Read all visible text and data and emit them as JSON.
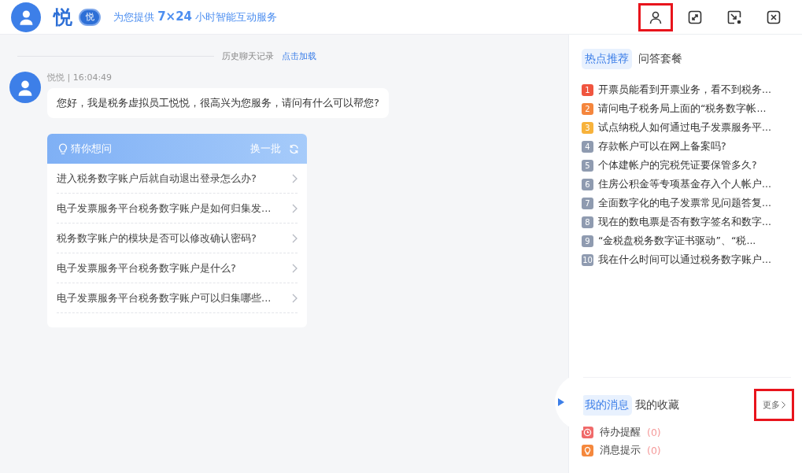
{
  "header": {
    "brand": "悦",
    "brand_badge": "悦",
    "slogan": "为您提供 **7×24** 小时智能互动服务",
    "tools": [
      {
        "kind": "user",
        "highlighted": true
      },
      {
        "kind": "expand",
        "highlighted": false
      },
      {
        "kind": "shrink",
        "highlighted": false
      },
      {
        "kind": "close",
        "highlighted": false
      }
    ]
  },
  "chat": {
    "history_label": "历史聊天记录",
    "history_link": "点击加载",
    "message": {
      "meta": "悦悦 | 16:04:49",
      "text": "您好，我是税务虚拟员工悦悦，很高兴为您服务，请问有什么可以帮您?"
    },
    "suggest": {
      "title": "猜你想问",
      "refresh": "换一批",
      "items": [
        "进入税务数字账户后就自动退出登录怎么办?",
        "电子发票服务平台税务数字账户是如何归集发...",
        "税务数字账户的模块是否可以修改确认密码?",
        "电子发票服务平台税务数字账户是什么?",
        "电子发票服务平台税务数字账户可以归集哪些..."
      ]
    }
  },
  "hot": {
    "tabs": [
      {
        "label": "热点推荐",
        "selected": true
      },
      {
        "label": "问答套餐",
        "selected": false
      }
    ],
    "items": [
      {
        "rank": "1",
        "color": "#f0553f",
        "text": "开票员能看到开票业务，看不到税务..."
      },
      {
        "rank": "2",
        "color": "#f5863d",
        "text": "请问电子税务局上面的“税务数字帐..."
      },
      {
        "rank": "3",
        "color": "#f7b23b",
        "text": "试点纳税人如何通过电子发票服务平..."
      },
      {
        "rank": "4",
        "color": "#8f9bb0",
        "text": "存款帐户可以在网上备案吗?"
      },
      {
        "rank": "5",
        "color": "#8f9bb0",
        "text": "个体建帐户的完税凭证要保管多久?"
      },
      {
        "rank": "6",
        "color": "#8f9bb0",
        "text": "住房公积金等专项基金存入个人帐户..."
      },
      {
        "rank": "7",
        "color": "#8f9bb0",
        "text": "全面数字化的电子发票常见问题答复..."
      },
      {
        "rank": "8",
        "color": "#8f9bb0",
        "text": "现在的数电票是否有数字签名和数字..."
      },
      {
        "rank": "9",
        "color": "#8f9bb0",
        "text": "“金税盘税务数字证书驱动”、“税..."
      },
      {
        "rank": "10",
        "color": "#8f9bb0",
        "text": "我在什么时间可以通过税务数字账户..."
      }
    ]
  },
  "messages": {
    "tabs": [
      {
        "label": "我的消息",
        "selected": true
      },
      {
        "label": "我的收藏",
        "selected": false
      }
    ],
    "more": {
      "label": "更多",
      "highlighted": true
    },
    "items": [
      {
        "kind": "todo",
        "color": "#f06a6a",
        "label": "待办提醒",
        "count": "(0)"
      },
      {
        "kind": "notice",
        "color": "#f5883d",
        "label": "消息提示",
        "count": "(0)"
      }
    ]
  }
}
